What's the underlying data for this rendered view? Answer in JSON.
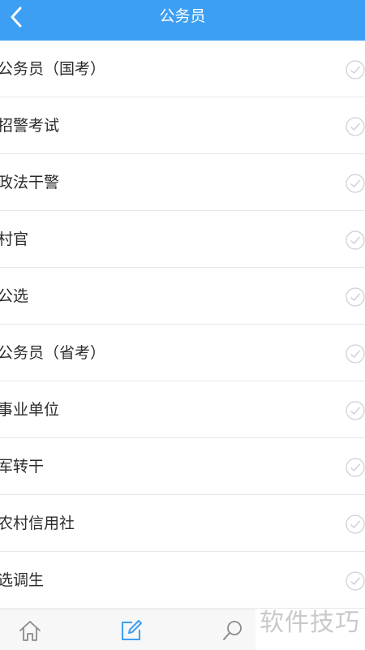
{
  "header": {
    "title": "公务员"
  },
  "list": {
    "items": [
      {
        "label": "公务员（国考）"
      },
      {
        "label": "招警考试"
      },
      {
        "label": "政法干警"
      },
      {
        "label": "村官"
      },
      {
        "label": "公选"
      },
      {
        "label": "公务员（省考）"
      },
      {
        "label": "事业单位"
      },
      {
        "label": "军转干"
      },
      {
        "label": "农村信用社"
      },
      {
        "label": "选调生"
      }
    ]
  },
  "tabs": [
    {
      "icon": "home-icon"
    },
    {
      "icon": "edit-icon"
    },
    {
      "icon": "search-icon"
    }
  ],
  "watermark": "软件技巧",
  "colors": {
    "header_bg": "#3c9ff3",
    "check_gray": "#cfcfcf",
    "tab_active": "#3c9ff3",
    "tab_inactive": "#8a8a8a"
  }
}
